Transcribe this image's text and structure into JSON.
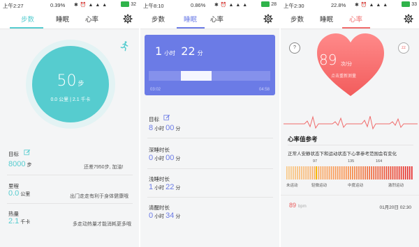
{
  "phones": [
    {
      "status": {
        "time": "上午2:27",
        "speed": "0.39%",
        "icons": "✱ ⏰ ▲ ▲ ▲",
        "battery": "32"
      },
      "tabs": [
        "步数",
        "睡眠",
        "心率"
      ],
      "active_tab": 0,
      "accent": "#56cccf",
      "steps": {
        "value": "50",
        "unit": "步",
        "sub": "0.0 公里 | 2.1 千卡"
      },
      "rows": [
        {
          "label": "目标",
          "value": "8000",
          "unit": "步",
          "note": "还差7950步, 加油!"
        },
        {
          "label": "里程",
          "value": "0.0",
          "unit": "公里",
          "note": "出门走走有利于身体健康哦"
        },
        {
          "label": "热量",
          "value": "2.1",
          "unit": "千卡",
          "note": "多走动热量才能消耗更多哦"
        }
      ]
    },
    {
      "status": {
        "time": "上午8:10",
        "speed": "0.86%",
        "icons": "✱ ⏰ ▲ ▲ ▲",
        "battery": "28"
      },
      "tabs": [
        "步数",
        "睡眠",
        "心率"
      ],
      "active_tab": 1,
      "accent": "#6b7be6",
      "sleep": {
        "hours": "1",
        "hours_unit": "小时",
        "minutes": "22",
        "minutes_unit": "分",
        "start": "03:02",
        "end": "04:58"
      },
      "rows": [
        {
          "label": "目标",
          "h": "8",
          "m": "00"
        },
        {
          "label": "深睡时长",
          "h": "0",
          "m": "00"
        },
        {
          "label": "浅睡时长",
          "h": "1",
          "m": "22"
        },
        {
          "label": "清醒时长",
          "h": "0",
          "m": "34"
        }
      ],
      "hour_unit": "小时",
      "min_unit": "分"
    },
    {
      "status": {
        "time": "上午2:30",
        "speed": "22.8%",
        "icons": "✱ ⏰ ▲ ▲ ▲",
        "battery": "33"
      },
      "tabs": [
        "步数",
        "睡眠",
        "心率"
      ],
      "active_tab": 2,
      "accent": "#f06b6b",
      "heart": {
        "value": "89",
        "unit": "次/分",
        "hint": "点击重新测量"
      },
      "help_btn": "?",
      "sleep_btn": "zz",
      "reference": {
        "title": "心率值参考",
        "desc": "正常人安静状态下和运动状态下心率参考范围会有变化",
        "ticks": [
          "97",
          "135",
          "164"
        ],
        "zones": [
          "未运动",
          "轻微运动",
          "中度运动",
          "激烈运动"
        ]
      },
      "record": {
        "value": "89",
        "unit": "bpm",
        "date": "01月20日 02:30"
      }
    }
  ]
}
